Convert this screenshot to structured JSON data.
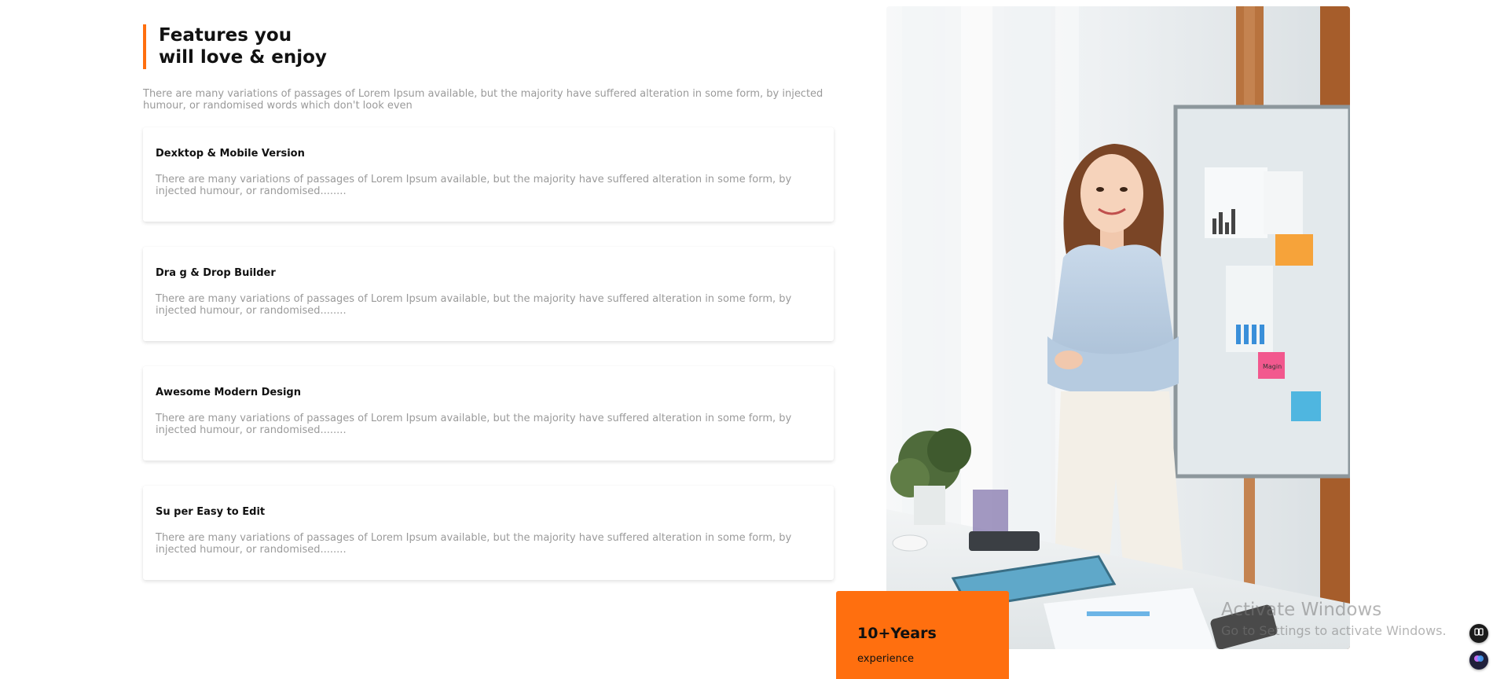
{
  "section": {
    "title_line1": "Features you",
    "title_line2": "will love & enjoy",
    "intro": "There are many variations of passages of Lorem Ipsum available, but the majority have suffered alteration in some form, by injected humour, or randomised words which don't look even"
  },
  "features": [
    {
      "title": "Dexktop & Mobile Version",
      "description": "There are many variations of passages of Lorem Ipsum available, but the majority have suffered alteration in some form, by injected humour, or randomised........"
    },
    {
      "title": "Dra g & Drop Builder",
      "description": "There are many variations of passages of Lorem Ipsum available, but the majority have suffered alteration in some form, by injected humour, or randomised........"
    },
    {
      "title": "Awesome Modern Design",
      "description": "There are many variations of passages of Lorem Ipsum available, but the majority have suffered alteration in some form, by injected humour, or randomised........"
    },
    {
      "title": "Su per Easy to Edit",
      "description": "There are many variations of passages of Lorem Ipsum available, but the majority have suffered alteration in some form, by injected humour, or randomised........"
    }
  ],
  "photo": {
    "icon": "office-woman-photo",
    "sticky_note_text": "Magin"
  },
  "badge": {
    "value": "10+Years",
    "label": "experience"
  },
  "watermark": {
    "line1": "Activate Windows",
    "line2": "Go to Settings to activate Windows."
  },
  "colors": {
    "accent": "#ff6f0f",
    "muted_text": "#9a9a9a",
    "heading_text": "#111111"
  },
  "floating_buttons": [
    {
      "icon": "reader-mode-icon"
    },
    {
      "icon": "ai-assistant-icon"
    }
  ]
}
